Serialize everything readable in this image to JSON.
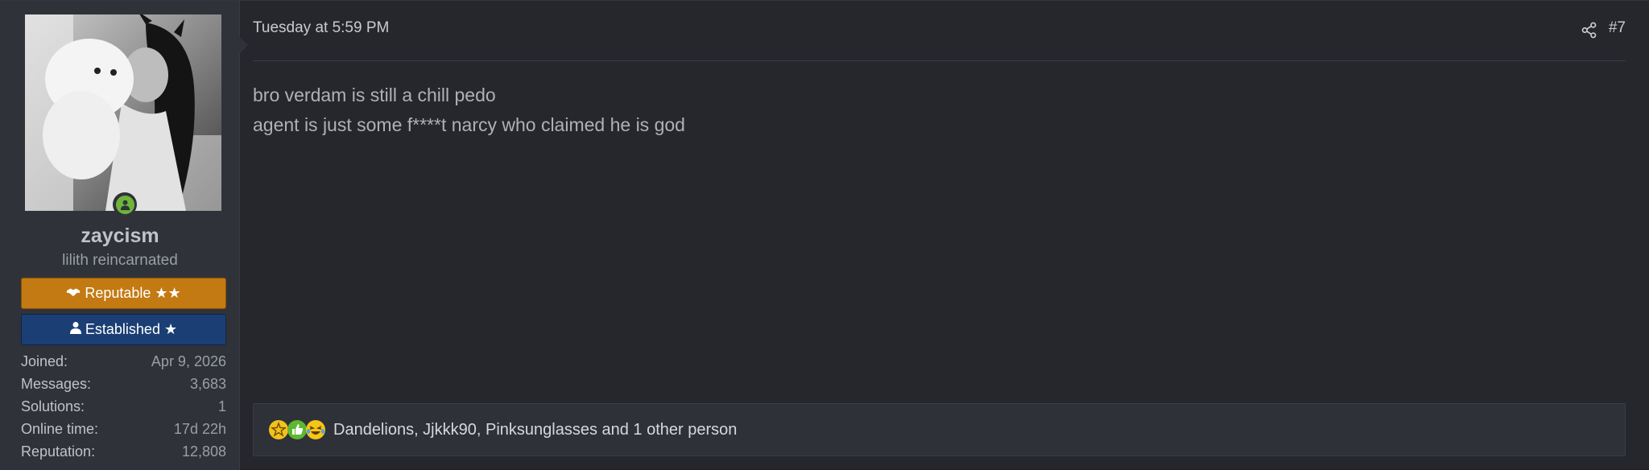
{
  "user": {
    "username": "zaycism",
    "user_title": "lilith reincarnated",
    "online_status_icon": "online-user-icon",
    "banners": [
      {
        "label": "Reputable ★★",
        "icon": "handshake-icon",
        "color": "#c37a12"
      },
      {
        "label": "Established ★",
        "icon": "user-icon",
        "color": "#1b3f74"
      }
    ],
    "stats": [
      {
        "label": "Joined:",
        "value": "Apr 9, 2026"
      },
      {
        "label": "Messages:",
        "value": "3,683"
      },
      {
        "label": "Solutions:",
        "value": "1"
      },
      {
        "label": "Online time:",
        "value": "17d 22h"
      },
      {
        "label": "Reputation:",
        "value": "12,808"
      }
    ]
  },
  "post": {
    "date": "Tuesday at 5:59 PM",
    "share_icon": "share-icon",
    "number": "#7",
    "lines": [
      "bro verdam is still a chill pedo",
      "agent is just some f****t narcy who claimed he is god"
    ],
    "reactions": {
      "icons": [
        "star-face-icon",
        "thumbs-up-icon",
        "laughing-icon"
      ],
      "text": "Dandelions, Jjkkk90, Pinksunglasses and 1 other person"
    }
  },
  "colors": {
    "background": "#25272c",
    "sidebar": "#2f3339",
    "reputable": "#c37a12",
    "established": "#1b3f74",
    "online": "#6fb53a"
  }
}
